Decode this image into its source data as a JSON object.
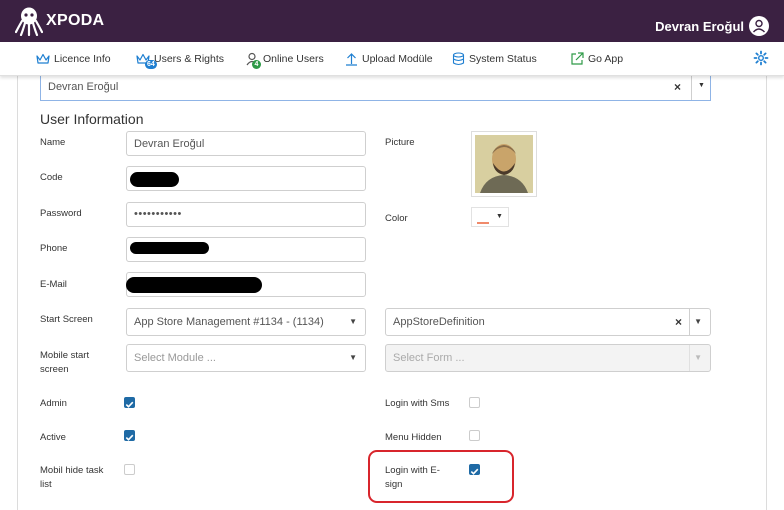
{
  "app": {
    "brand": "XPODA",
    "user_name": "Devran Eroğul"
  },
  "nav": {
    "items": [
      {
        "label": "Licence Info",
        "icon": "crown-icon"
      },
      {
        "label": "Users & Rights",
        "icon": "users-rights-icon",
        "badge": "64"
      },
      {
        "label": "Online Users",
        "icon": "online-user-icon",
        "badge": "4"
      },
      {
        "label": "Upload Modüle",
        "icon": "upload-icon"
      },
      {
        "label": "System Status",
        "icon": "database-icon"
      },
      {
        "label": "Go App",
        "icon": "external-link-icon"
      }
    ],
    "settings_icon": "gear-icon",
    "colors": {
      "badge_blue": "#1f7fd1",
      "badge_green": "#2e9a47",
      "accent": "#1f6aa5",
      "header": "#3b2142"
    }
  },
  "user_select": {
    "value": "Devran Eroğul",
    "clear": "×"
  },
  "form": {
    "section_title": "User Information",
    "name_label": "Name",
    "name_value": "Devran Eroğul",
    "code_label": "Code",
    "password_label": "Password",
    "password_value": "•••••••••••",
    "phone_label": "Phone",
    "email_label": "E-Mail",
    "start_screen_label": "Start Screen",
    "start_screen_value": "App Store Management #1134 - (1134)",
    "start_form_value": "AppStoreDefinition",
    "mobile_start_label": "Mobile start screen",
    "mobile_module_placeholder": "Select Module ...",
    "mobile_form_placeholder": "Select Form ...",
    "picture_label": "Picture",
    "color_label": "Color",
    "admin_label": "Admin",
    "admin_checked": true,
    "active_label": "Active",
    "active_checked": true,
    "mobil_hide_label": "Mobil hide task list",
    "mobil_hide_checked": false,
    "login_sms_label": "Login with Sms",
    "login_sms_checked": false,
    "menu_hidden_label": "Menu Hidden",
    "menu_hidden_checked": false,
    "login_esign_label": "Login with E-sign",
    "login_esign_checked": true
  }
}
